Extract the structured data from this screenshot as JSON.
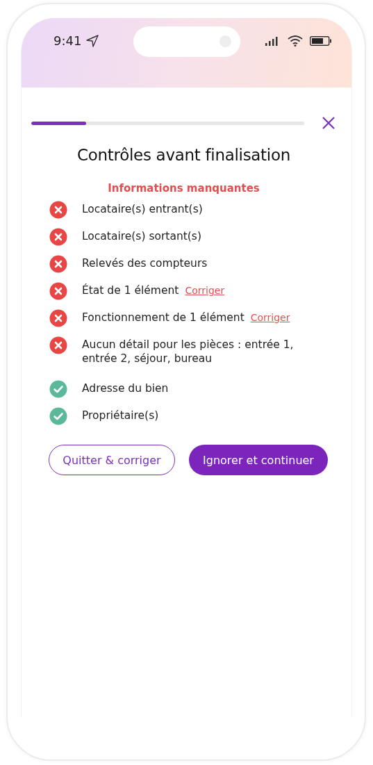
{
  "status_bar": {
    "time": "9:41"
  },
  "progress": {
    "level": 0.2
  },
  "title": "Contrôles avant finalisation",
  "section": "Informations manquantes",
  "checks": [
    {
      "label": "Locataire(s) entrant(s)",
      "passed": false
    },
    {
      "label": "Locataire(s) sortant(s)",
      "passed": false
    },
    {
      "label": "Relevés des compteurs",
      "passed": false
    },
    {
      "label": "État de 1 élément",
      "passed": false,
      "link": "Corriger"
    },
    {
      "label": "Fonctionnement de 1 élément",
      "passed": false,
      "link": "Corriger"
    },
    {
      "label": "Aucun détail pour les pièces : entrée 1, entrée 2, séjour, bureau",
      "passed": false
    },
    {
      "label": "Adresse du bien",
      "passed": true
    },
    {
      "label": "Propriétaire(s)",
      "passed": true
    }
  ],
  "buttons": [
    {
      "label": "Quitter & corriger",
      "kind": "outline"
    },
    {
      "label": "Ignorer et continuer",
      "kind": "primary"
    }
  ]
}
